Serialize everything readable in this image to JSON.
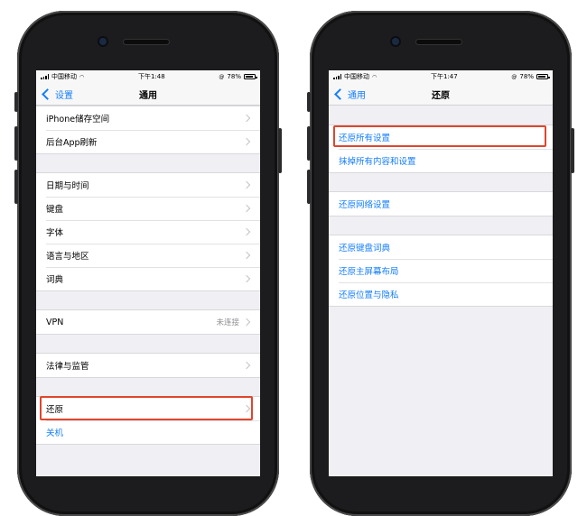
{
  "left": {
    "status": {
      "carrier": "中国移动",
      "time": "下午1:48",
      "battery": "78%"
    },
    "nav": {
      "back": "设置",
      "title": "通用"
    },
    "groups": [
      [
        {
          "label": "iPhone储存空间"
        },
        {
          "label": "后台App刷新"
        }
      ],
      [
        {
          "label": "日期与时间"
        },
        {
          "label": "键盘"
        },
        {
          "label": "字体"
        },
        {
          "label": "语言与地区"
        },
        {
          "label": "词典"
        }
      ],
      [
        {
          "label": "VPN",
          "value": "未连接"
        }
      ],
      [
        {
          "label": "法律与监管"
        }
      ],
      [
        {
          "label": "还原"
        },
        {
          "label": "关机"
        }
      ]
    ]
  },
  "right": {
    "status": {
      "carrier": "中国移动",
      "time": "下午1:47",
      "battery": "78%"
    },
    "nav": {
      "back": "通用",
      "title": "还原"
    },
    "groups": [
      [
        {
          "label": "还原所有设置"
        },
        {
          "label": "抹掉所有内容和设置"
        }
      ],
      [
        {
          "label": "还原网络设置"
        }
      ],
      [
        {
          "label": "还原键盘词典"
        },
        {
          "label": "还原主屏幕布局"
        },
        {
          "label": "还原位置与隐私"
        }
      ]
    ]
  },
  "colors": {
    "highlight": "#e0452d",
    "accent": "#147efb"
  },
  "icons": [
    "signal-icon",
    "wifi-icon",
    "battery-icon",
    "chevron-left-icon",
    "chevron-right-icon"
  ]
}
